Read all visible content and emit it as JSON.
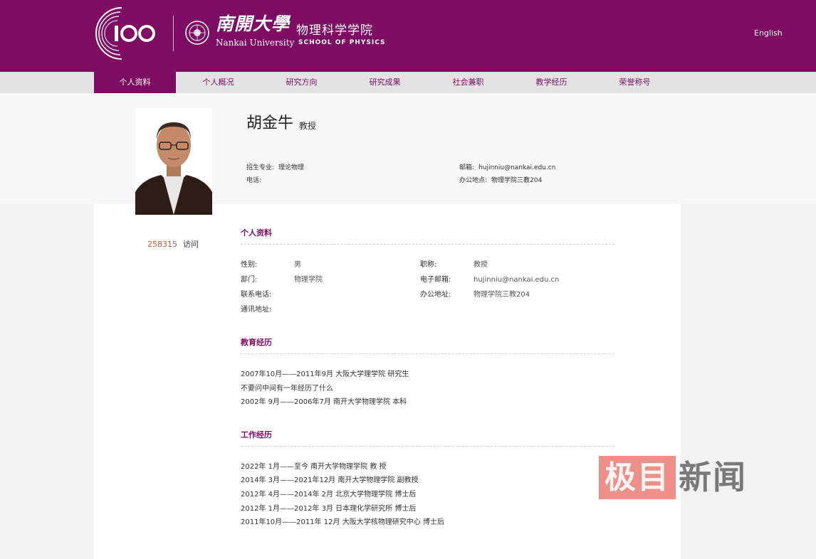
{
  "header": {
    "logo_number": "100",
    "university_cn": "南開大學",
    "school_cn": "物理科学学院",
    "university_en": "Nankai University",
    "school_en": "SCHOOL OF PHYSICS",
    "language_link": "English"
  },
  "nav": {
    "items": [
      {
        "label": "个人资料",
        "active": true
      },
      {
        "label": "个人概况"
      },
      {
        "label": "研究方向"
      },
      {
        "label": "研究成果"
      },
      {
        "label": "社会兼职"
      },
      {
        "label": "教学经历"
      },
      {
        "label": "荣誉称号"
      }
    ]
  },
  "profile": {
    "name": "胡金牛",
    "title": "教授",
    "major_label": "招生专业:",
    "major_value": "理论物理",
    "phone_label": "电话:",
    "phone_value": "",
    "email_label": "邮箱:",
    "email_value": "hujinniu@nankai.edu.cn",
    "office_label": "办公地点:",
    "office_value": "物理学院三教204",
    "visit_count": "258315",
    "visit_label": "访问"
  },
  "personal": {
    "section_title": "个人资料",
    "gender_label": "性别:",
    "gender_value": "男",
    "position_label": "职称:",
    "position_value": "教授",
    "dept_label": "部门:",
    "dept_value": "物理学院",
    "email_label": "电子邮箱:",
    "email_value": "hujinniu@nankai.edu.cn",
    "phone_label": "联系电话:",
    "phone_value": "",
    "office_label": "办公地址:",
    "office_value": "物理学院三教204",
    "address_label": "通讯地址:",
    "address_value": ""
  },
  "education": {
    "section_title": "教育经历",
    "items": [
      "2007年10月——2011年9月 大阪大学理学院 研究生",
      "不要问中间有一年经历了什么",
      "2002年 9月——2006年7月 南开大学物理学院 本科"
    ]
  },
  "work": {
    "section_title": "工作经历",
    "items": [
      "2022年 1月——至今 南开大学物理学院 教 授",
      "2014年 3月——2021年12月 南开大学物理学院 副教授",
      "2012年 4月——2014年 2月 北京大学物理学院 博士后",
      "2012年 1月——2012年 3月 日本理化学研究所 博士后",
      "2011年10月——2011年 12月 大阪大学核物理研究中心 博士后"
    ]
  },
  "watermark": {
    "box_text": "极目",
    "text": "新闻"
  },
  "colors": {
    "brand": "#7e0c63",
    "visit_count": "#c05a35",
    "watermark_red": "#e0342a"
  }
}
